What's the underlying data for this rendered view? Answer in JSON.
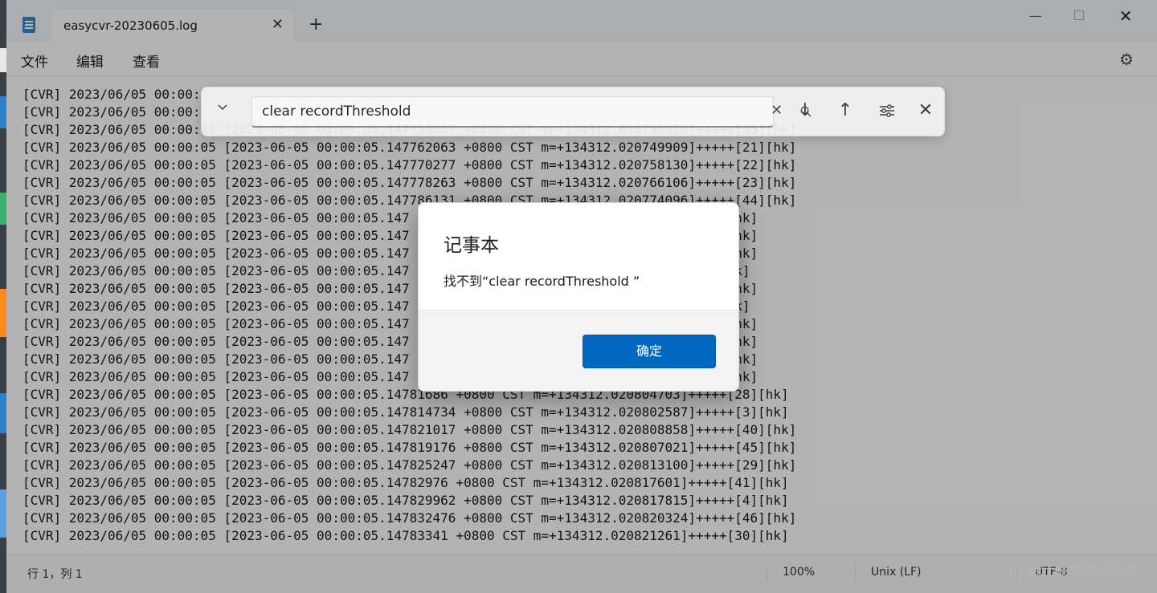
{
  "window": {
    "tab_title": "easycvr-20230605.log",
    "tab_close_icon": "close-icon",
    "new_tab_symbol": "+",
    "minimize_symbol": "—",
    "close_symbol": "✕"
  },
  "menu": {
    "file": "文件",
    "edit": "编辑",
    "view": "查看"
  },
  "find": {
    "query": "clear recordThreshold",
    "clear_symbol": "✕",
    "toggle_symbol": "⌄",
    "next_symbol": "↓",
    "prev_symbol": "↑",
    "close_symbol": "✕"
  },
  "editor": {
    "lines": [
      "[CVR] 2023/06/05 00:00:",
      "[CVR] 2023/06/05 00:00:",
      "[CVR] 2023/06/05 00:00:05 [2023-06-05 00:00:05.147750807 +0800 CST m=+134312.020738030]+++++[35][hk]",
      "[CVR] 2023/06/05 00:00:05 [2023-06-05 00:00:05.147762063 +0800 CST m=+134312.020749909]+++++[21][hk]",
      "[CVR] 2023/06/05 00:00:05 [2023-06-05 00:00:05.147770277 +0800 CST m=+134312.020758130]+++++[22][hk]",
      "[CVR] 2023/06/05 00:00:05 [2023-06-05 00:00:05.147778263 +0800 CST m=+134312.020766106]+++++[23][hk]",
      "[CVR] 2023/06/05 00:00:05 [2023-06-05 00:00:05.147786131 +0800 CST m=+134312.020774096]+++++[44][hk]",
      "[CVR] 2023/06/05 00:00:05 [2023-06-05 00:00:05.147                                  +++[24][hk]",
      "[CVR] 2023/06/05 00:00:05 [2023-06-05 00:00:05.147                                  +++[36][hk]",
      "[CVR] 2023/06/05 00:00:05 [2023-06-05 00:00:05.147                                  +++[25][hk]",
      "[CVR] 2023/06/05 00:00:05 [2023-06-05 00:00:05.147                                  ++[37][hk]",
      "[CVR] 2023/06/05 00:00:05 [2023-06-05 00:00:05.147                                  +++[26][hk]",
      "[CVR] 2023/06/05 00:00:05 [2023-06-05 00:00:05.147                                  ++[38][hk]",
      "[CVR] 2023/06/05 00:00:05 [2023-06-05 00:00:05.147                                  +++[20][hk]",
      "[CVR] 2023/06/05 00:00:05 [2023-06-05 00:00:05.147                                  +++[27][hk]",
      "[CVR] 2023/06/05 00:00:05 [2023-06-05 00:00:05.147                                  +++[55][hk]",
      "[CVR] 2023/06/05 00:00:05 [2023-06-05 00:00:05.147                                  +++[39][hk]",
      "[CVR] 2023/06/05 00:00:05 [2023-06-05 00:00:05.14781686 +0800 CST m=+134312.020804703]+++++[28][hk]",
      "[CVR] 2023/06/05 00:00:05 [2023-06-05 00:00:05.147814734 +0800 CST m=+134312.020802587]+++++[3][hk]",
      "[CVR] 2023/06/05 00:00:05 [2023-06-05 00:00:05.147821017 +0800 CST m=+134312.020808858]+++++[40][hk]",
      "[CVR] 2023/06/05 00:00:05 [2023-06-05 00:00:05.147819176 +0800 CST m=+134312.020807021]+++++[45][hk]",
      "[CVR] 2023/06/05 00:00:05 [2023-06-05 00:00:05.147825247 +0800 CST m=+134312.020813100]+++++[29][hk]",
      "[CVR] 2023/06/05 00:00:05 [2023-06-05 00:00:05.14782976 +0800 CST m=+134312.020817601]+++++[41][hk]",
      "[CVR] 2023/06/05 00:00:05 [2023-06-05 00:00:05.147829962 +0800 CST m=+134312.020817815]+++++[4][hk]",
      "[CVR] 2023/06/05 00:00:05 [2023-06-05 00:00:05.147832476 +0800 CST m=+134312.020820324]+++++[46][hk]",
      "[CVR] 2023/06/05 00:00:05 [2023-06-05 00:00:05.14783341 +0800 CST m=+134312.020821261]+++++[30][hk]"
    ]
  },
  "status": {
    "position": "行 1，列 1",
    "zoom": "100%",
    "line_ending": "Unix (LF)",
    "encoding": "UTF-8"
  },
  "watermark": {
    "text": "稀土掘金技术社区",
    "badge": "@"
  },
  "dialog": {
    "title": "记事本",
    "message": "找不到“clear recordThreshold ”",
    "ok_label": "确定"
  }
}
